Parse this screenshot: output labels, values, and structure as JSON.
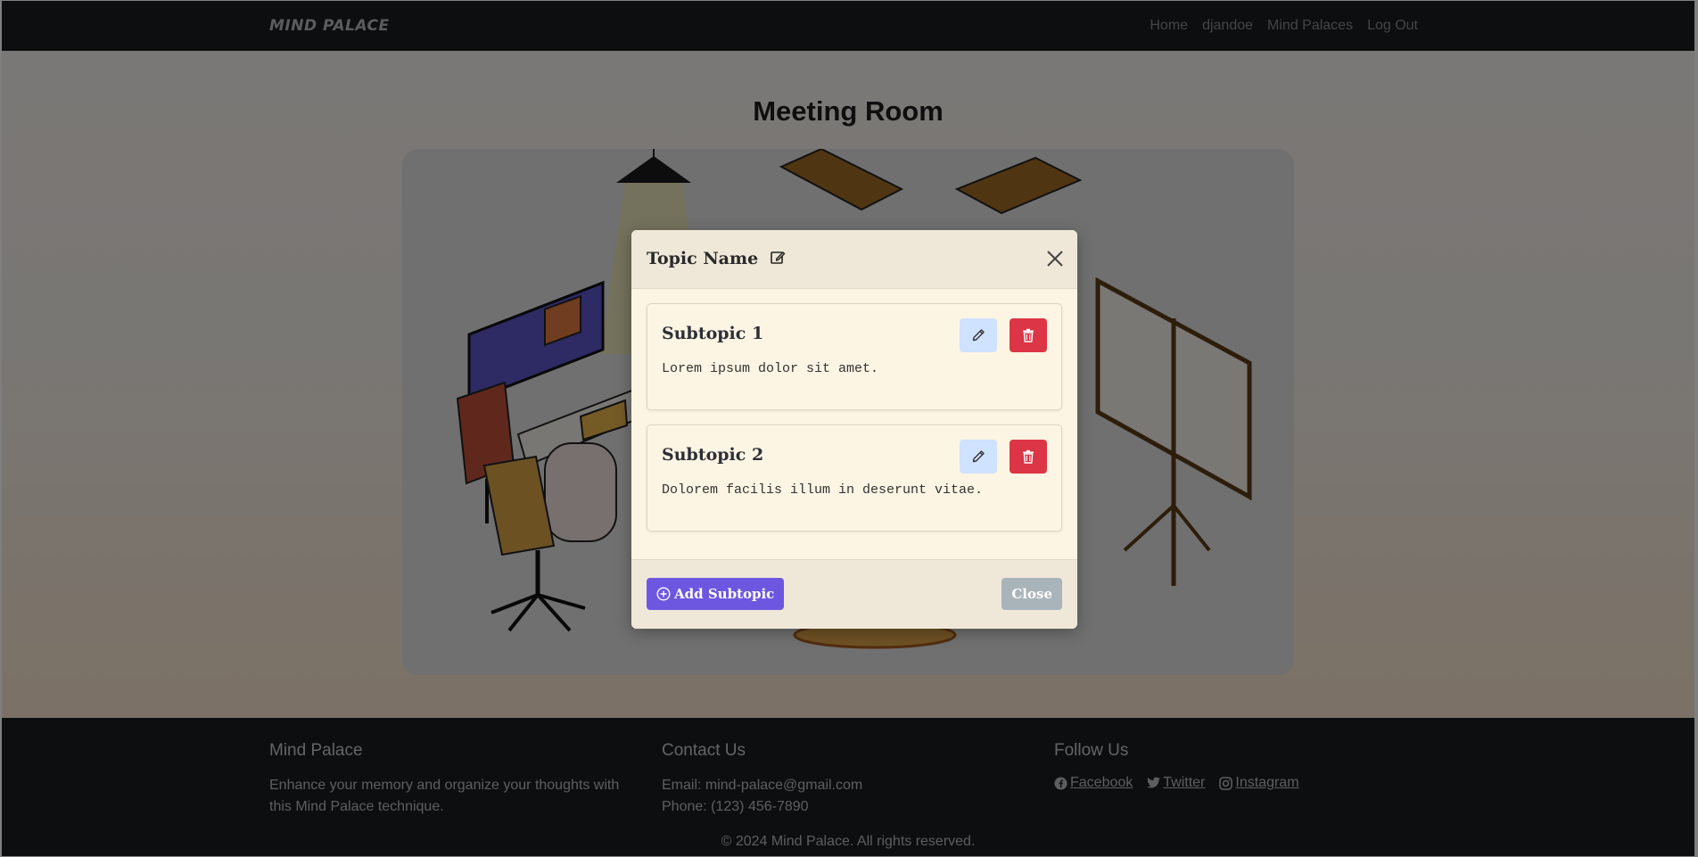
{
  "navbar": {
    "brand": "MIND PALACE",
    "links": [
      "Home",
      "djandoe",
      "Mind Palaces",
      "Log Out"
    ]
  },
  "room": {
    "title": "Meeting Room"
  },
  "modal": {
    "title": "Topic Name",
    "subtopics": [
      {
        "title": "Subtopic 1",
        "text": "Lorem ipsum dolor sit amet."
      },
      {
        "title": "Subtopic 2",
        "text": "Dolorem facilis illum in deserunt vitae."
      }
    ],
    "add_label": "Add Subtopic",
    "close_label": "Close"
  },
  "footer": {
    "about": {
      "heading": "Mind Palace",
      "text": "Enhance your memory and organize your thoughts with this Mind Palace technique."
    },
    "contact": {
      "heading": "Contact Us",
      "email": "Email: mind-palace@gmail.com",
      "phone": "Phone: (123) 456-7890"
    },
    "social": {
      "heading": "Follow Us",
      "links": [
        "Facebook",
        "Twitter",
        "Instagram"
      ]
    },
    "copyright": "© 2024 Mind Palace. All rights reserved."
  },
  "colors": {
    "accent_purple": "#6e57e0",
    "danger_red": "#dc3545",
    "edit_blue": "#cfe2ff",
    "modal_bg": "#fdf5e3"
  }
}
